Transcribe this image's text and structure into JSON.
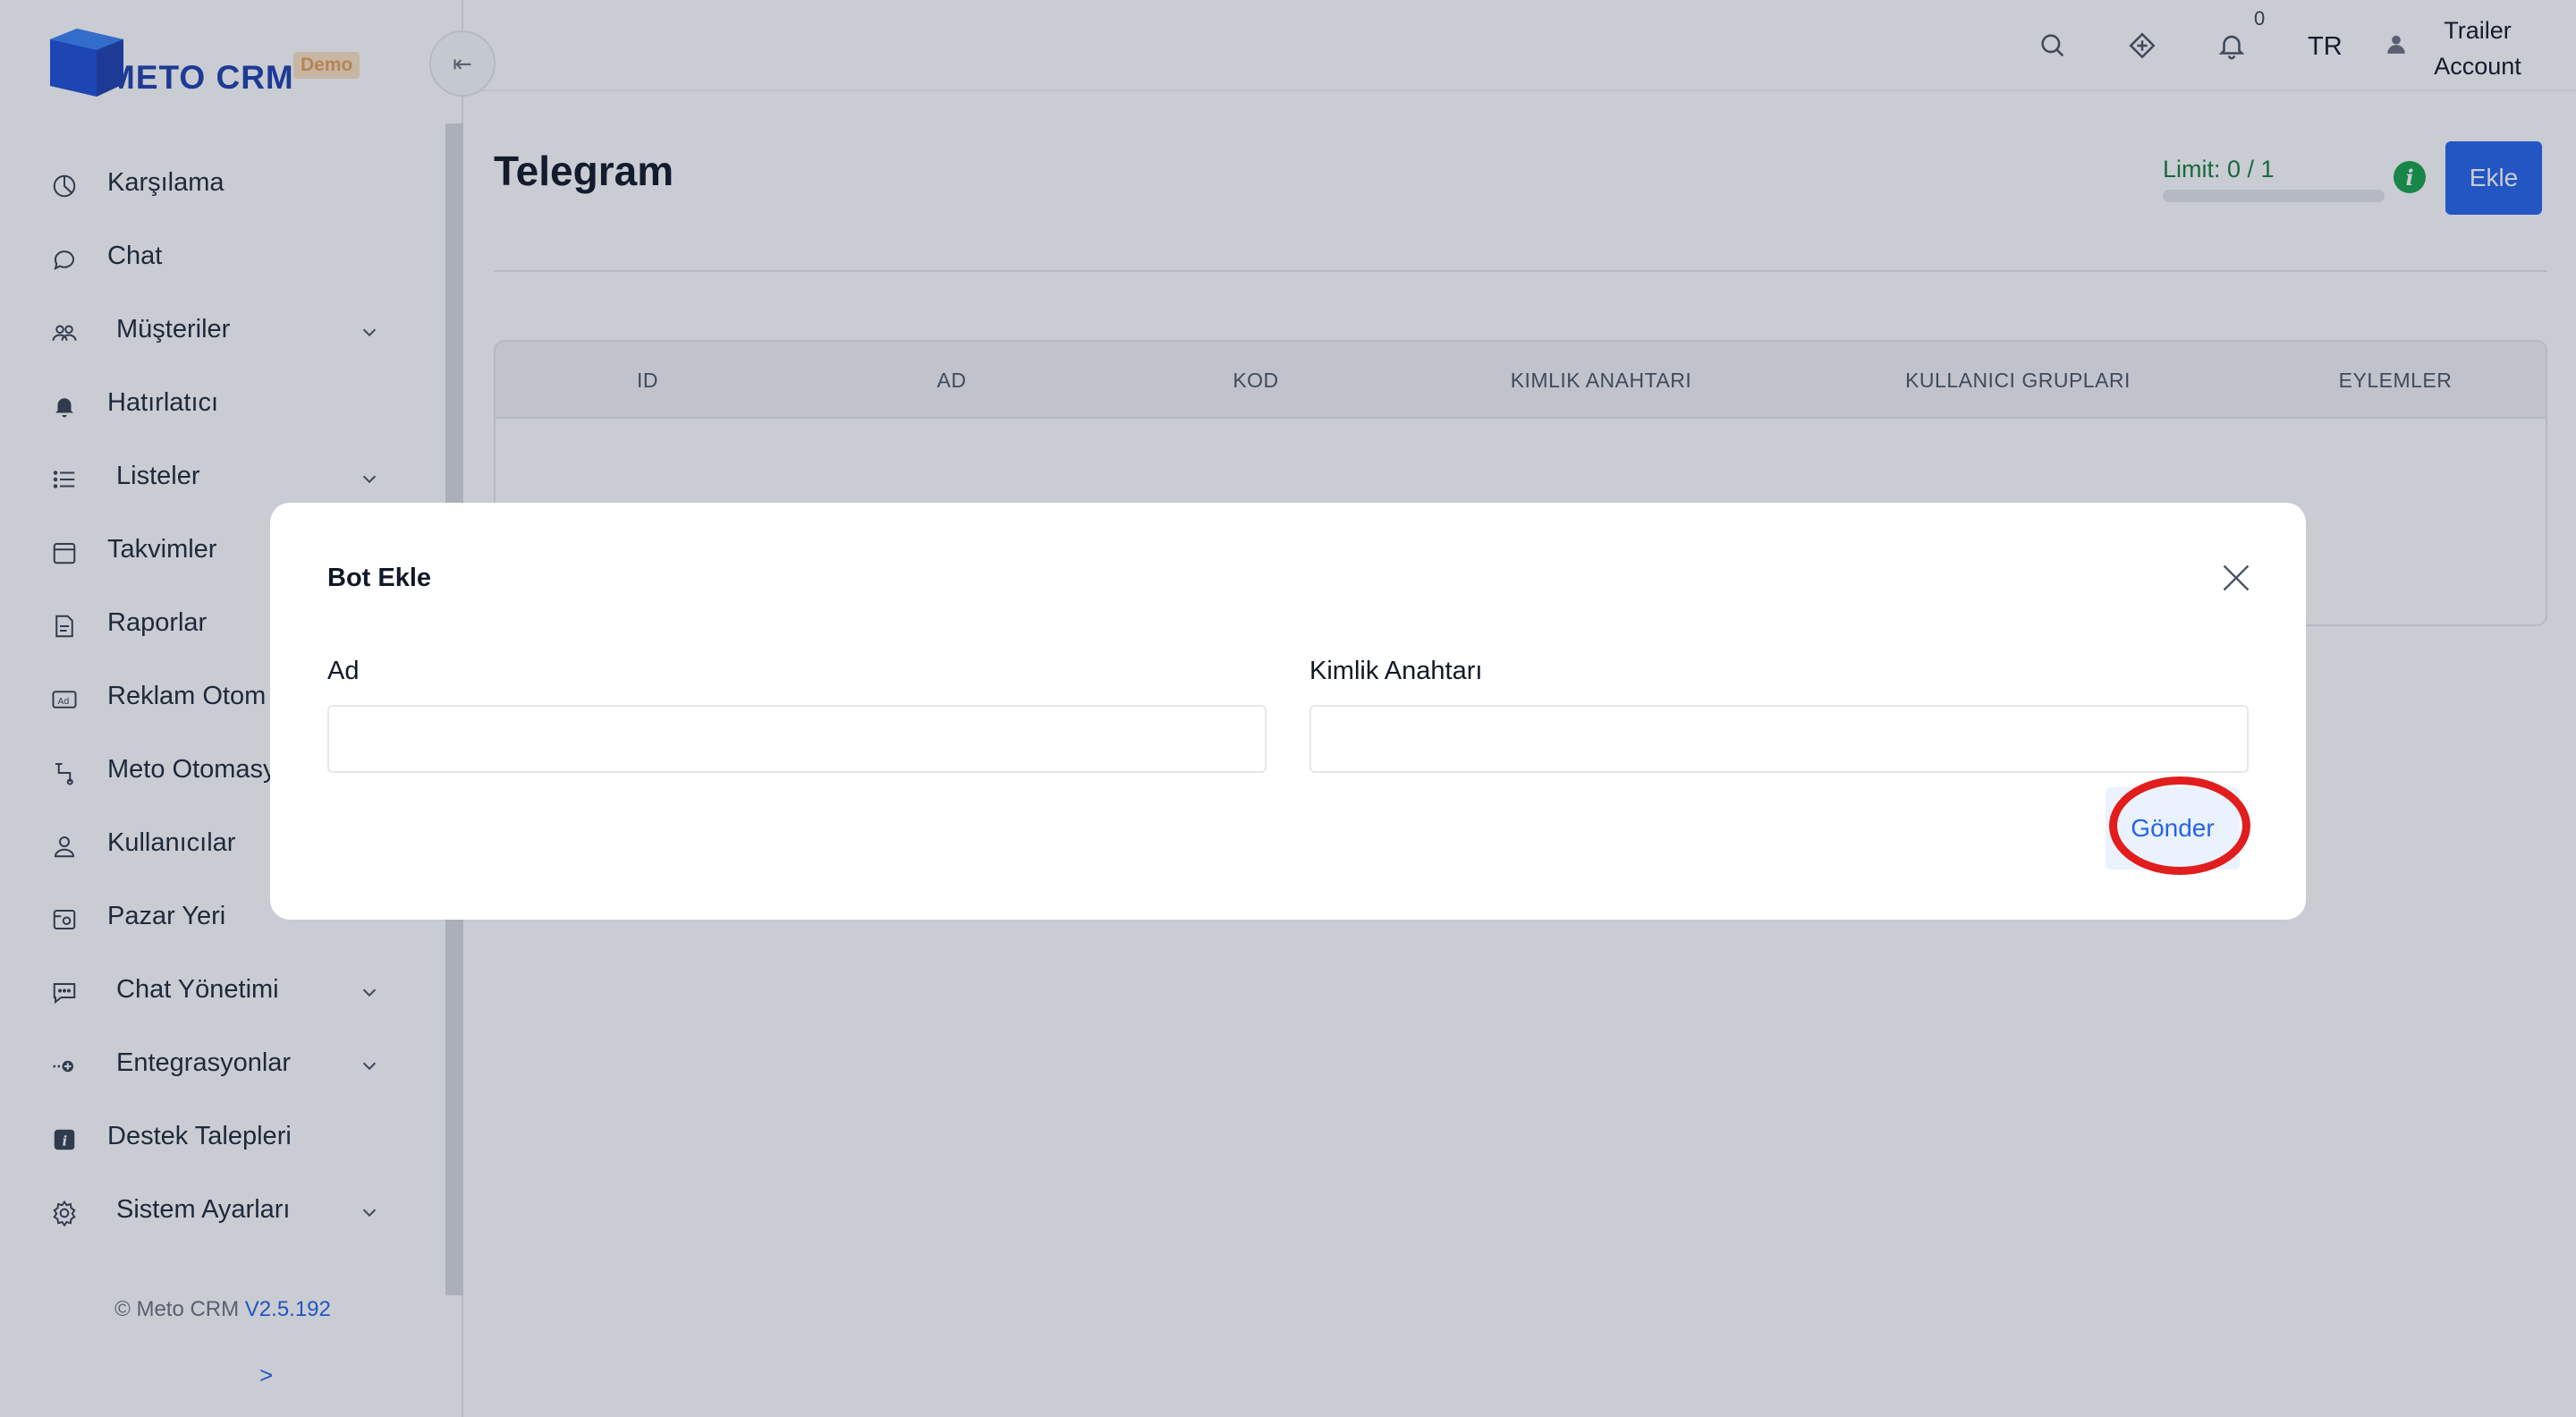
{
  "brand": {
    "name": "METO CRM",
    "badge": "Demo",
    "color": "#1e40af"
  },
  "sidebar": {
    "items": [
      {
        "label": "Karşılama",
        "icon": "pie-chart-icon",
        "has_chevron": false
      },
      {
        "label": "Chat",
        "icon": "chat-bubble-icon",
        "has_chevron": false
      },
      {
        "label": "Müşteriler",
        "icon": "users-icon",
        "has_chevron": true
      },
      {
        "label": "Hatırlatıcı",
        "icon": "bell-icon",
        "has_chevron": false
      },
      {
        "label": "Listeler",
        "icon": "list-icon",
        "has_chevron": true
      },
      {
        "label": "Takvimler",
        "icon": "calendar-icon",
        "has_chevron": false
      },
      {
        "label": "Raporlar",
        "icon": "report-icon",
        "has_chevron": false
      },
      {
        "label": "Reklam Otom",
        "icon": "ad-icon",
        "has_chevron": false
      },
      {
        "label": "Meto Otomasy",
        "icon": "automation-icon",
        "has_chevron": false
      },
      {
        "label": "Kullanıcılar",
        "icon": "user-icon",
        "has_chevron": false
      },
      {
        "label": "Pazar Yeri",
        "icon": "marketplace-icon",
        "has_chevron": false
      },
      {
        "label": "Chat Yönetimi",
        "icon": "chat-settings-icon",
        "has_chevron": true
      },
      {
        "label": "Entegrasyonlar",
        "icon": "integration-icon",
        "has_chevron": true
      },
      {
        "label": "Destek Talepleri",
        "icon": "info-square-icon",
        "has_chevron": false
      },
      {
        "label": "Sistem Ayarları",
        "icon": "gear-icon",
        "has_chevron": true
      }
    ],
    "footer_text": "© Meto CRM",
    "footer_version": "V2.5.192",
    "expand_arrow": ">"
  },
  "header": {
    "notification_count": "0",
    "language": "TR",
    "account_line1": "Trailer",
    "account_line2": "Account"
  },
  "page": {
    "title": "Telegram",
    "limit_text": "Limit: 0 / 1",
    "limit_fraction": 0.0,
    "add_button": "Ekle",
    "table_headers": [
      "ID",
      "AD",
      "KOD",
      "KIMLIK ANAHTARI",
      "KULLANICI GRUPLARI",
      "EYLEMLER"
    ]
  },
  "modal": {
    "title": "Bot Ekle",
    "fields": [
      {
        "label": "Ad",
        "value": "",
        "placeholder": ""
      },
      {
        "label": "Kimlik Anahtarı",
        "value": "",
        "placeholder": ""
      }
    ],
    "submit_label": "Gönder",
    "highlight_color": "#e11d1d"
  }
}
